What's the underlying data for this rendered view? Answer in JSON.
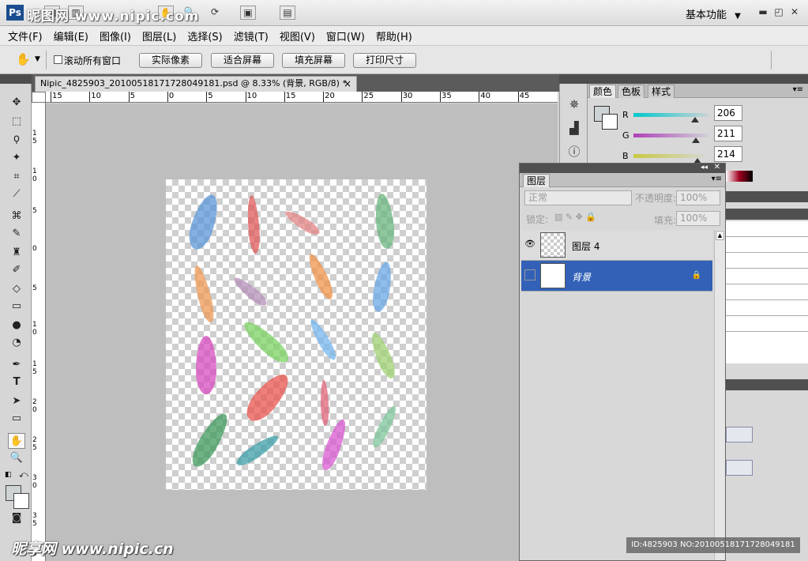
{
  "title_bar": {
    "logo": "Ps",
    "watermark": "昵图网 www.nipic.com",
    "workspace_label": "基本功能",
    "workspace_arrow": "▼"
  },
  "menu": [
    "文件(F)",
    "编辑(E)",
    "图像(I)",
    "图层(L)",
    "选择(S)",
    "滤镜(T)",
    "视图(V)",
    "窗口(W)",
    "帮助(H)"
  ],
  "options": {
    "scroll_all_label": "滚动所有窗口",
    "buttons": [
      "实际像素",
      "适合屏幕",
      "填充屏幕",
      "打印尺寸"
    ]
  },
  "document": {
    "tab_title": "Nipic_4825903_20100518171728049181.psd @ 8.33% (背景, RGB/8) *",
    "ruler_h": [
      "15",
      "10",
      "5",
      "0",
      "5",
      "10",
      "15",
      "20",
      "25",
      "30",
      "35",
      "40",
      "45"
    ]
  },
  "color_panel": {
    "tabs": [
      "颜色",
      "色板",
      "样式"
    ],
    "channels": [
      {
        "label": "R",
        "value": "206",
        "level": 206
      },
      {
        "label": "G",
        "value": "211",
        "level": 211
      },
      {
        "label": "B",
        "value": "214",
        "level": 214
      }
    ]
  },
  "layers_panel": {
    "tab": "图层",
    "blend_mode": "正常",
    "opacity_label": "不透明度:",
    "opacity_value": "100%",
    "lock_label": "锁定:",
    "fill_label": "填充:",
    "fill_value": "100%",
    "layers": [
      {
        "name": "图层 4",
        "visible": true,
        "selected": false
      },
      {
        "name": "背景",
        "visible": false,
        "selected": true
      }
    ]
  },
  "watermark_bottom": {
    "brand": "昵享网 www.nipic.cn",
    "id_text": "ID:4825903 NO:20100518171728049181"
  }
}
